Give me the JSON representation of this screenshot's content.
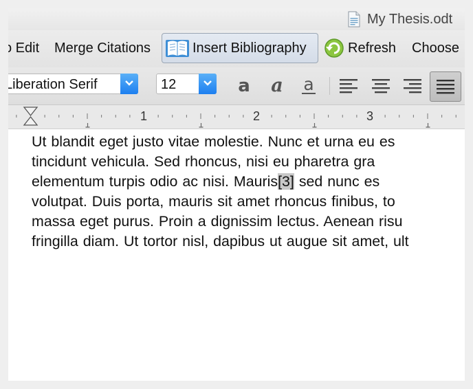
{
  "window": {
    "title": "My Thesis.odt"
  },
  "zotero_toolbar": {
    "edit_label": "o Edit",
    "merge_label": "Merge Citations",
    "insert_bib_label": "Insert Bibliography",
    "refresh_label": "Refresh",
    "choose_label": "Choose"
  },
  "format_toolbar": {
    "font_name": "Liberation Serif",
    "font_size": "12"
  },
  "ruler": {
    "marks": [
      "1",
      "2",
      "3"
    ]
  },
  "document": {
    "lines": [
      "Ut blandit eget justo vitae molestie. Nunc et urna eu es",
      "tincidunt vehicula. Sed rhoncus, nisi eu pharetra gra",
      "elementum turpis odio ac nisi. Mauris",
      "volutpat. Duis porta, mauris sit amet rhoncus finibus, to",
      "massa eget purus. Proin a dignissim lectus. Aenean risu",
      "fringilla diam. Ut tortor nisl, dapibus ut augue sit amet, ult"
    ],
    "citation": "[3]",
    "line3_after": " sed nunc es"
  }
}
